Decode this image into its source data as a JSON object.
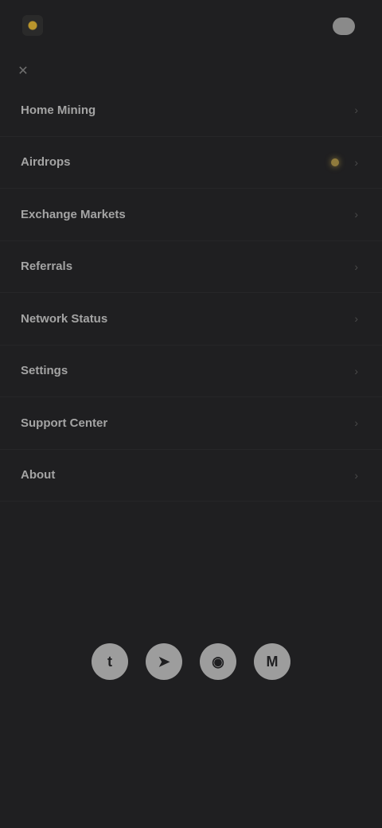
{
  "header": {
    "logo_text": "",
    "link_label": "",
    "button_label": ""
  },
  "close_icon": "✕",
  "menu": {
    "items": [
      {
        "label": "Home Mining",
        "chevron": "›"
      },
      {
        "label": "Airdrops",
        "chevron": "›",
        "badge": true
      },
      {
        "label": "Exchange Markets",
        "chevron": "›"
      },
      {
        "label": "Referrals",
        "chevron": "›"
      },
      {
        "label": "Network Status",
        "chevron": "›"
      },
      {
        "label": "Settings",
        "chevron": "›"
      },
      {
        "label": "Support Center",
        "chevron": "›"
      },
      {
        "label": "About",
        "chevron": "›"
      }
    ]
  },
  "footer": {
    "text": "",
    "social": [
      {
        "icon": "twitter-icon",
        "glyph": "t"
      },
      {
        "icon": "telegram-icon",
        "glyph": "➤"
      },
      {
        "icon": "discord-icon",
        "glyph": "◉"
      },
      {
        "icon": "medium-icon",
        "glyph": "M"
      }
    ]
  },
  "colors": {
    "background": "#1f1f21",
    "accent": "#8f7a3c"
  }
}
